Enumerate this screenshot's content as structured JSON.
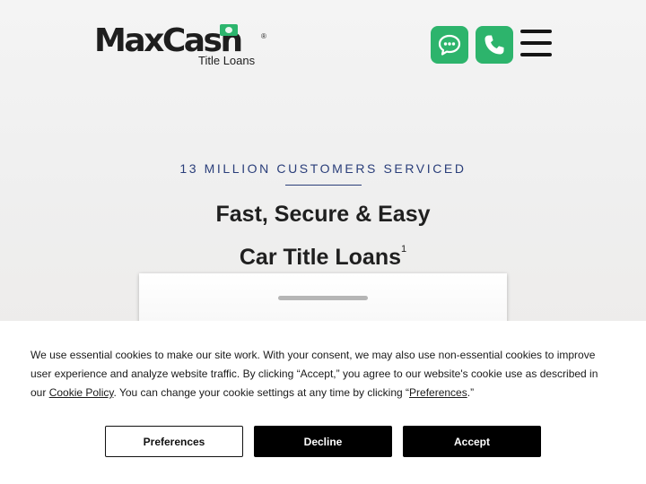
{
  "header": {
    "logo": {
      "brand": "MaxCash",
      "registered_mark": "®",
      "subtitle": "Title Loans"
    },
    "icons": {
      "chat": "chat-bubble-icon",
      "phone": "phone-icon",
      "menu": "hamburger-menu-icon"
    },
    "colors": {
      "accent": "#2db46c",
      "menu": "#151515"
    }
  },
  "hero": {
    "eyebrow": "13 MILLION CUSTOMERS SERVICED",
    "headline_line1": "Fast, Secure & Easy",
    "headline_line2": "Car Title Loans",
    "footnote": "1",
    "colors": {
      "eyebrow": "#2a3e7a"
    }
  },
  "cookie_banner": {
    "text_part1": "We use essential cookies to make our site work. With your consent, we may also use non-essential cookies to improve user experience and analyze website traffic. By clicking “Accept,” you agree to our website's cookie use as described in our ",
    "cookie_policy_link": "Cookie Policy",
    "text_part2": ". You can change your cookie settings at any time by clicking “",
    "preferences_link": "Preferences",
    "text_part3": ".”",
    "buttons": {
      "preferences": "Preferences",
      "decline": "Decline",
      "accept": "Accept"
    }
  }
}
